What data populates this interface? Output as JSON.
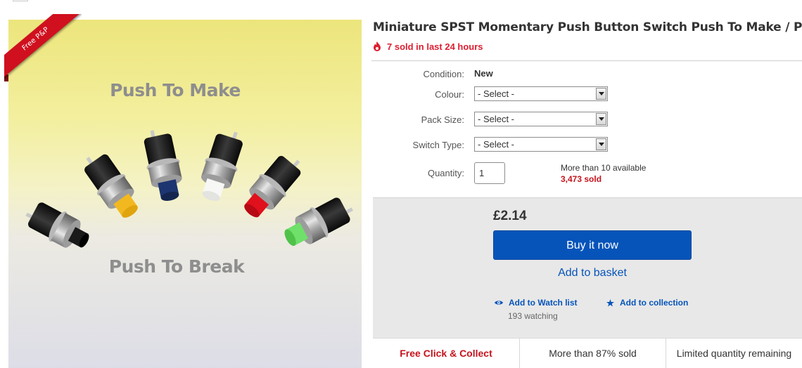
{
  "image": {
    "badge_text": "Free P&P",
    "headline_top": "Push To Make",
    "headline_bottom": "Push To Break",
    "button_colors": [
      "#1b1b1b",
      "#f2b820",
      "#1d3570",
      "#f7f7f5",
      "#e0101c",
      "#6fe06a"
    ]
  },
  "product": {
    "title": "Miniature SPST Momentary Push Button Switch Push To Make / Push To Break",
    "sold_recent": "7 sold in last 24 hours"
  },
  "details": {
    "condition_label": "Condition:",
    "condition_value": "New",
    "colour_label": "Colour:",
    "colour_value": "- Select -",
    "pack_label": "Pack Size:",
    "pack_value": "- Select -",
    "switch_label": "Switch Type:",
    "switch_value": "- Select -",
    "quantity_label": "Quantity:",
    "quantity_value": "1",
    "availability": "More than 10 available",
    "sold_total": "3,473 sold"
  },
  "purchase": {
    "price": "£2.14",
    "buy_label": "Buy it now",
    "basket_label": "Add to basket",
    "watch_label": "Add to Watch list",
    "collection_label": "Add to collection",
    "watching": "193 watching"
  },
  "highlights": {
    "click_collect": "Free Click & Collect",
    "percent_sold": "More than 87% sold",
    "limited": "Limited quantity remaining"
  },
  "colors": {
    "accent_blue": "#0654ba",
    "alert_red": "#dd1e31",
    "badge_red": "#d0101f"
  }
}
